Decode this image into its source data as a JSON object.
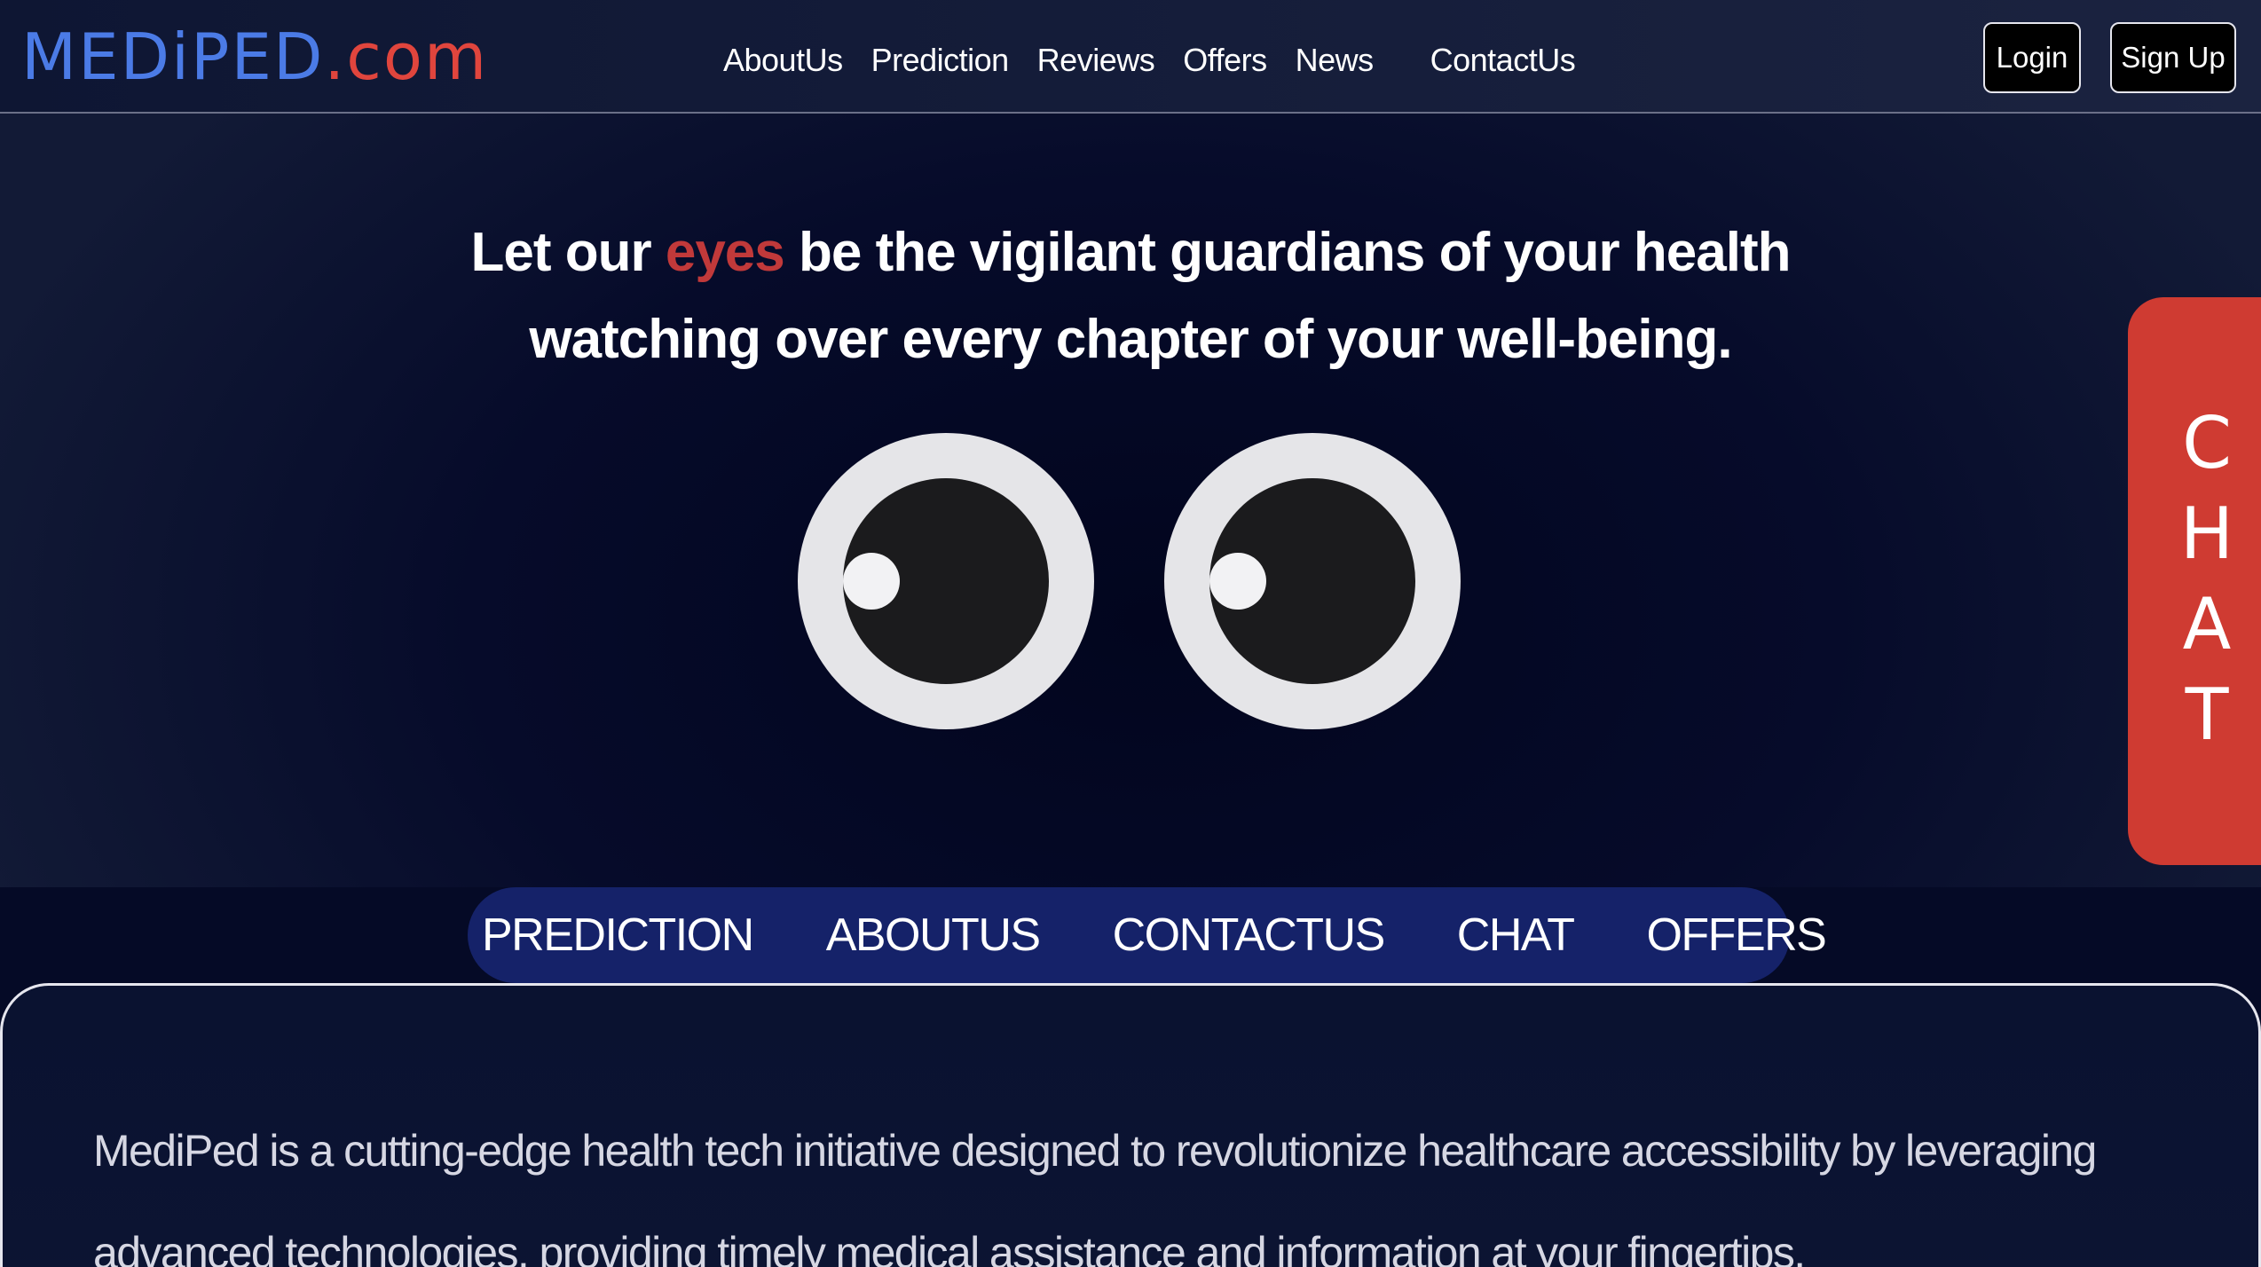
{
  "logo": {
    "brand": "MEDiPED",
    "tld": ".com"
  },
  "nav": {
    "links": [
      "AboutUs",
      "Prediction",
      "Reviews",
      "Offers",
      "News"
    ],
    "contact": "ContactUs"
  },
  "auth": {
    "login": "Login",
    "signup": "Sign Up"
  },
  "hero": {
    "line1_before": "Let our ",
    "line1_accent": "eyes",
    "line1_after": " be the vigilant guardians of your health",
    "line2": "watching over every chapter of your well-being."
  },
  "chat_tab": {
    "letters": [
      "C",
      "H",
      "A",
      "T"
    ]
  },
  "pill_nav": {
    "items": [
      "PREDICTION",
      "ABOUTUS",
      "CONTACTUS",
      "CHAT",
      "OFFERS"
    ]
  },
  "about": {
    "text": "MediPed is a cutting-edge health tech initiative designed to revolutionize healthcare accessibility by leveraging advanced technologies, providing timely medical assistance and information at your fingertips."
  },
  "colors": {
    "brand_blue": "#4b7be6",
    "brand_red": "#e0453d",
    "accent_red": "#c1393a",
    "chat_red": "#cf3b32",
    "pill_navy": "#152269",
    "background": "#050a26"
  },
  "icons": [
    "eye-icon",
    "eye-icon"
  ]
}
